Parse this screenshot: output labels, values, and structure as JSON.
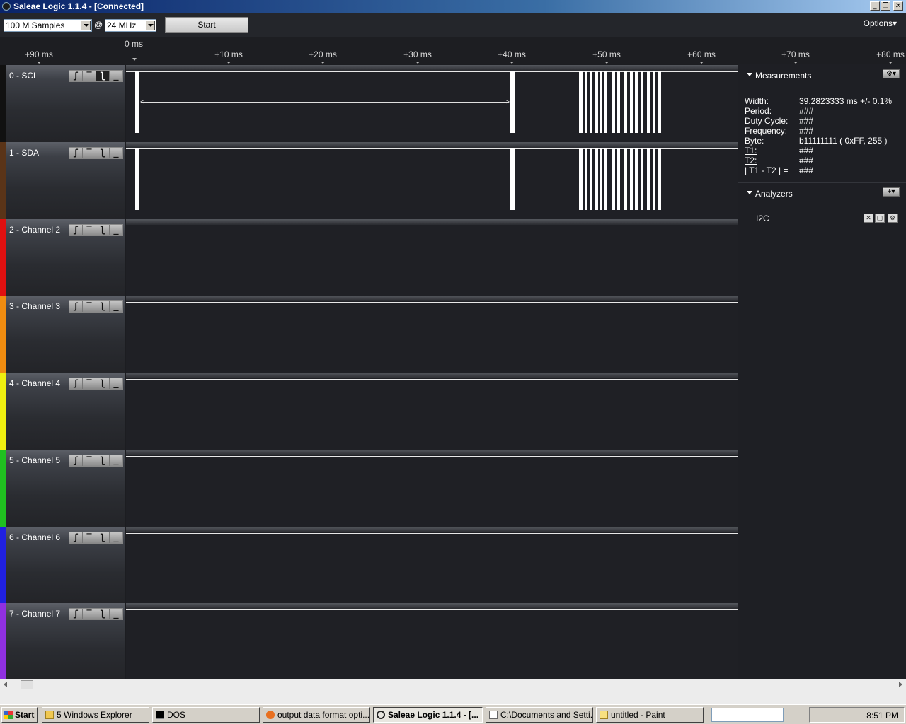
{
  "window": {
    "title": "Saleae Logic 1.1.4 - [Connected]",
    "minimize": "_",
    "restore": "❐",
    "close": "✕"
  },
  "toolbar": {
    "samples_value": "100 M Samples",
    "at": "@",
    "rate_value": "24 MHz",
    "start_label": "Start",
    "options_label": "Options▾"
  },
  "ruler": {
    "zero_label": "0 ms",
    "ticks": [
      "+90 ms",
      "+10 ms",
      "+20 ms",
      "+30 ms",
      "+40 ms",
      "+50 ms",
      "+60 ms",
      "+70 ms",
      "+80 ms"
    ]
  },
  "channels": [
    {
      "name": "0 - SCL",
      "color": "#111111"
    },
    {
      "name": "1 - SDA",
      "color": "#5a3418"
    },
    {
      "name": "2 - Channel 2",
      "color": "#e01010"
    },
    {
      "name": "3 - Channel 3",
      "color": "#f08c10"
    },
    {
      "name": "4 - Channel 4",
      "color": "#f0f010"
    },
    {
      "name": "5 - Channel 5",
      "color": "#20c020"
    },
    {
      "name": "6 - Channel 6",
      "color": "#2020e0"
    },
    {
      "name": "7 - Channel 7",
      "color": "#9030e0"
    }
  ],
  "trigger_glyphs": [
    "ʃ",
    "‾",
    "ʅ",
    "_"
  ],
  "measurements": {
    "title": "Measurements",
    "gear": "⚙▾",
    "rows": [
      {
        "key": "Width:",
        "value": "39.2823333 ms +/- 0.1%"
      },
      {
        "key": "Period:",
        "value": "###"
      },
      {
        "key": "Duty Cycle:",
        "value": "###"
      },
      {
        "key": "Frequency:",
        "value": "###"
      },
      {
        "key": "Byte:",
        "value": "b11111111 ( 0xFF, 255 )"
      },
      {
        "key": "T1:",
        "value": "###"
      },
      {
        "key": "T2:",
        "value": "###"
      },
      {
        "key": "| T1 - T2 | =",
        "value": "###"
      }
    ]
  },
  "analyzers": {
    "title": "Analyzers",
    "add": "+▾",
    "items": [
      {
        "name": "I2C"
      }
    ]
  },
  "taskbar": {
    "start": "Start",
    "tasks": [
      {
        "label": "5 Windows Explorer"
      },
      {
        "label": "DOS"
      },
      {
        "label": "output data format opti..."
      },
      {
        "label": "Saleae Logic 1.1.4 - [..."
      },
      {
        "label": "C:\\Documents and Setti..."
      },
      {
        "label": "untitled - Paint"
      }
    ],
    "clock": "8:51 PM"
  }
}
